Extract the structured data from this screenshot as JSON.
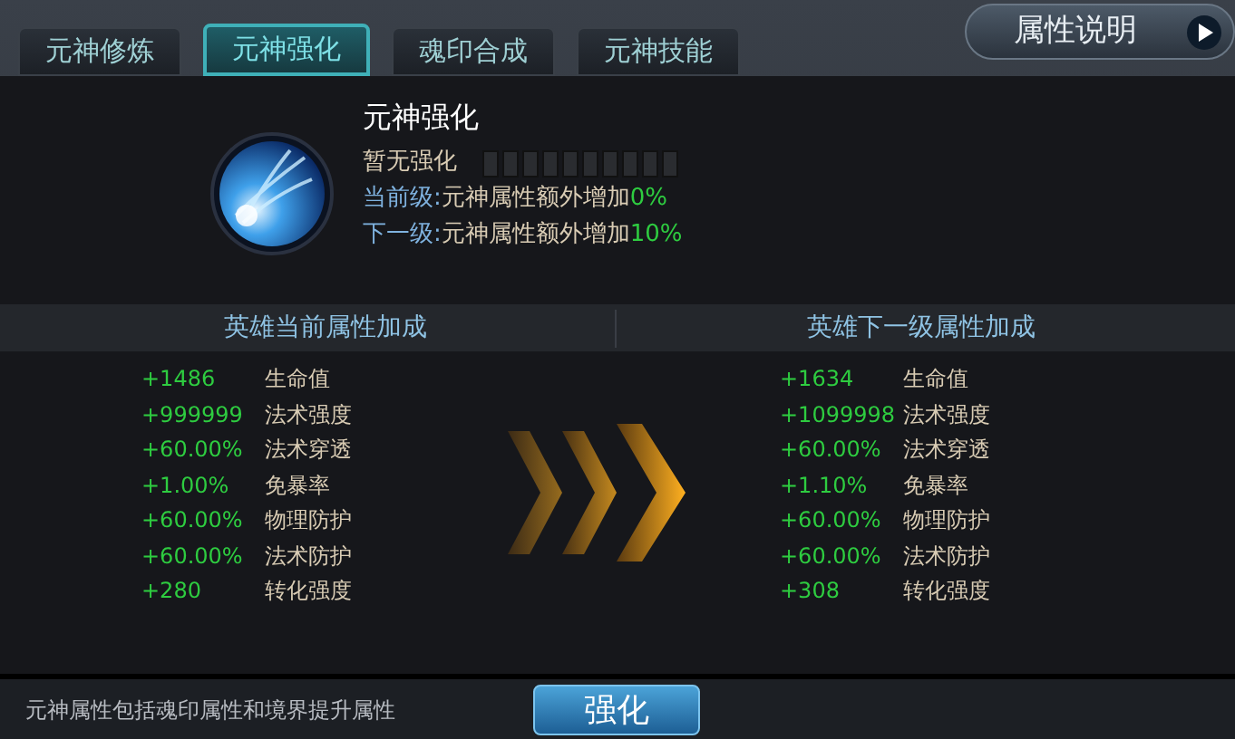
{
  "tabs": [
    {
      "label": "元神修炼",
      "selected": false
    },
    {
      "label": "元神强化",
      "selected": true
    },
    {
      "label": "魂印合成",
      "selected": false
    },
    {
      "label": "元神技能",
      "selected": false
    }
  ],
  "help_button": {
    "label": "属性说明"
  },
  "enhance": {
    "title": "元神强化",
    "status": "暂无强化",
    "levels": [
      {
        "label": "当前级:",
        "text": "元神属性额外增加",
        "value": "0%"
      },
      {
        "label": "下一级:",
        "text": "元神属性额外增加",
        "value": "10%"
      }
    ]
  },
  "current": {
    "title": "英雄当前属性加成",
    "rows": [
      {
        "value": "+1486",
        "name": "生命值"
      },
      {
        "value": "+999999",
        "name": "法术强度"
      },
      {
        "value": "+60.00%",
        "name": "法术穿透"
      },
      {
        "value": "+1.00%",
        "name": "免暴率"
      },
      {
        "value": "+60.00%",
        "name": "物理防护"
      },
      {
        "value": "+60.00%",
        "name": "法术防护"
      },
      {
        "value": "+280",
        "name": "转化强度"
      }
    ]
  },
  "next": {
    "title": "英雄下一级属性加成",
    "rows": [
      {
        "value": "+1634",
        "name": "生命值"
      },
      {
        "value": "+1099998",
        "name": "法术强度"
      },
      {
        "value": "+60.00%",
        "name": "法术穿透"
      },
      {
        "value": "+1.10%",
        "name": "免暴率"
      },
      {
        "value": "+60.00%",
        "name": "物理防护"
      },
      {
        "value": "+60.00%",
        "name": "法术防护"
      },
      {
        "value": "+308",
        "name": "转化强度"
      }
    ]
  },
  "footer": {
    "note": "元神属性包括魂印属性和境界提升属性",
    "button": "强化"
  }
}
